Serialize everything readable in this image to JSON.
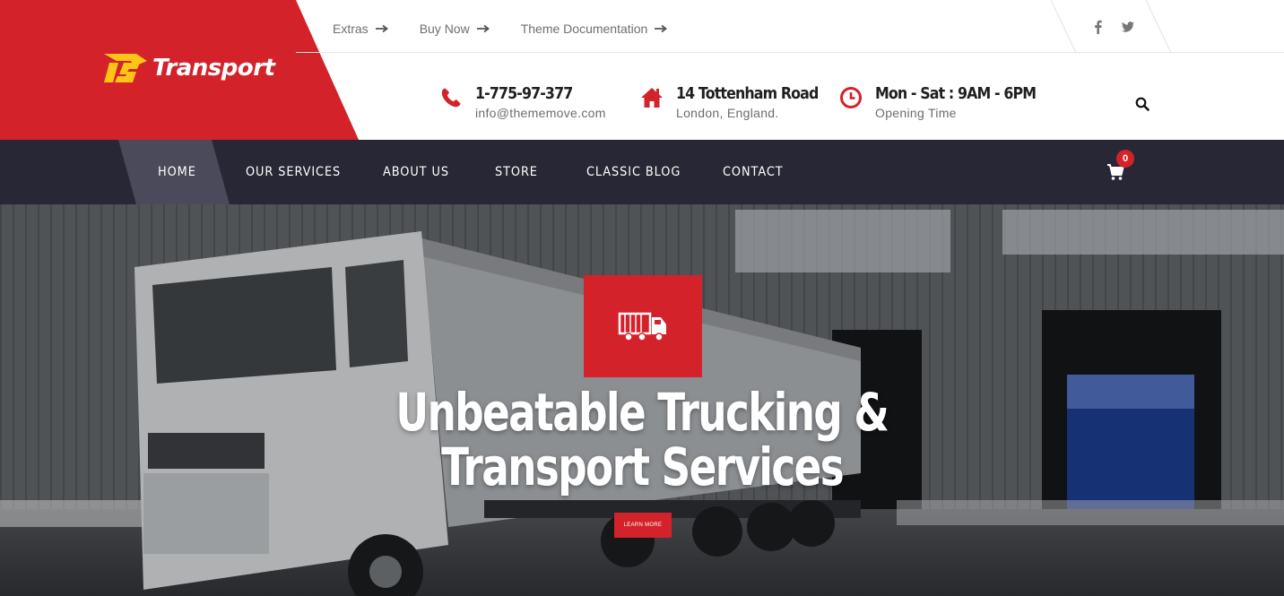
{
  "brand": {
    "name": "Transport",
    "logo_mark": "TS",
    "accent": "#d3222a",
    "dark": "#272735",
    "logo_yellow": "#ffc516"
  },
  "topbar": {
    "links": [
      {
        "label": "Extras",
        "icon": "arrow-right-icon"
      },
      {
        "label": "Buy Now",
        "icon": "arrow-right-icon"
      },
      {
        "label": "Theme Documentation",
        "icon": "arrow-right-icon"
      }
    ],
    "social": [
      "facebook-icon",
      "twitter-icon"
    ]
  },
  "contact": {
    "phone": {
      "title": "1-775-97-377",
      "sub": "info@thememove.com",
      "icon": "phone-icon"
    },
    "address": {
      "title": "14 Tottenham Road",
      "sub": "London, England.",
      "icon": "home-icon"
    },
    "hours": {
      "title": "Mon - Sat : 9AM - 6PM",
      "sub": "Opening Time",
      "icon": "clock-icon"
    }
  },
  "nav": {
    "items": [
      "HOME",
      "OUR SERVICES",
      "ABOUT US",
      "STORE",
      "CLASSIC BLOG",
      "CONTACT"
    ],
    "active": "HOME",
    "cart_count": "0"
  },
  "hero": {
    "icon": "truck-icon",
    "title_line1": "Unbeatable Trucking &",
    "title_line2": "Transport Services",
    "button": "LEARN MORE"
  }
}
